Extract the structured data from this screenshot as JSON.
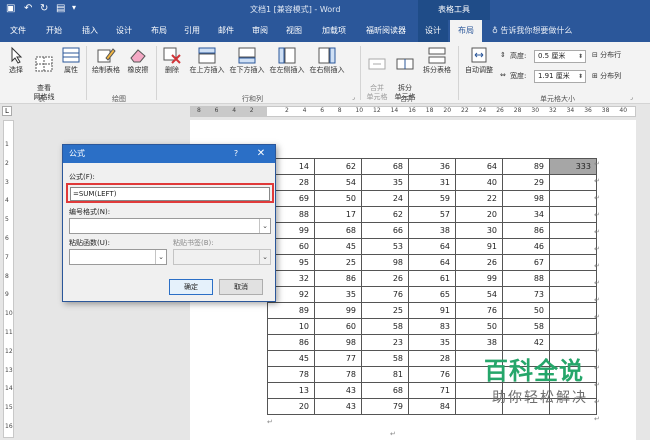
{
  "titlebar": {
    "doc_title": "文档1 [兼容模式] - Word",
    "context_group": "表格工具"
  },
  "tabs": [
    "文件",
    "开始",
    "插入",
    "设计",
    "布局",
    "引用",
    "邮件",
    "审阅",
    "视图",
    "加载项",
    "福昕阅读器",
    "设计",
    "布局"
  ],
  "tell_me": "告诉我你想要做什么",
  "ribbon": {
    "groups": {
      "table": "表",
      "draw": "绘图",
      "rows_cols": "行和列",
      "merge": "合并",
      "cell_size": "单元格大小"
    },
    "buttons": {
      "select": "选择",
      "gridlines": "查看\n网格线",
      "properties": "属性",
      "draw_table": "绘制表格",
      "eraser": "橡皮擦",
      "delete": "删除",
      "insert_above": "在上方插入",
      "insert_below": "在下方插入",
      "insert_left": "在左侧插入",
      "insert_right": "在右侧插入",
      "merge_cells": "合并\n单元格",
      "split_cells": "拆分\n单元格",
      "split_table": "拆分表格",
      "autofit": "自动调整",
      "distribute_rows": "分布行",
      "distribute_cols": "分布列"
    },
    "height_label": "高度:",
    "height_value": "0.5 厘米",
    "width_label": "宽度:",
    "width_value": "1.91 厘米"
  },
  "ruler_ticks": [
    "8",
    "6",
    "4",
    "2",
    "",
    "2",
    "4",
    "6",
    "8",
    "10",
    "12",
    "14",
    "16",
    "18",
    "20",
    "22",
    "24",
    "26",
    "28",
    "30",
    "32",
    "34",
    "36",
    "38",
    "40"
  ],
  "vruler_ticks": [
    "1",
    "2",
    "3",
    "4",
    "5",
    "6",
    "7",
    "8",
    "9",
    "10",
    "11",
    "12",
    "13",
    "14",
    "15",
    "16"
  ],
  "table": {
    "rows": [
      [
        "14",
        "62",
        "68",
        "36",
        "64",
        "89",
        "333"
      ],
      [
        "28",
        "54",
        "35",
        "31",
        "40",
        "29",
        ""
      ],
      [
        "69",
        "50",
        "24",
        "59",
        "22",
        "98",
        ""
      ],
      [
        "88",
        "17",
        "62",
        "57",
        "20",
        "34",
        ""
      ],
      [
        "99",
        "68",
        "66",
        "38",
        "30",
        "86",
        ""
      ],
      [
        "60",
        "45",
        "53",
        "64",
        "91",
        "46",
        ""
      ],
      [
        "95",
        "25",
        "98",
        "64",
        "26",
        "67",
        ""
      ],
      [
        "32",
        "86",
        "26",
        "61",
        "99",
        "88",
        ""
      ],
      [
        "92",
        "35",
        "76",
        "65",
        "54",
        "73",
        ""
      ],
      [
        "89",
        "99",
        "25",
        "91",
        "76",
        "50",
        ""
      ],
      [
        "10",
        "60",
        "58",
        "83",
        "50",
        "58",
        ""
      ],
      [
        "86",
        "98",
        "23",
        "35",
        "38",
        "42",
        ""
      ],
      [
        "45",
        "77",
        "58",
        "28",
        "",
        "",
        ""
      ],
      [
        "78",
        "78",
        "81",
        "76",
        "",
        "",
        ""
      ],
      [
        "13",
        "43",
        "68",
        "71",
        "",
        "",
        ""
      ],
      [
        "20",
        "43",
        "79",
        "84",
        "",
        "",
        ""
      ]
    ]
  },
  "dialog": {
    "title": "公式",
    "help": "?",
    "close": "✕",
    "formula_label": "公式(F):",
    "formula_value": "=SUM(LEFT)",
    "number_format_label": "编号格式(N):",
    "paste_function_label": "粘贴函数(U):",
    "paste_bookmark_label": "粘贴书签(B):",
    "ok": "确定",
    "cancel": "取消"
  },
  "watermark": {
    "main": "百科全说",
    "sub": "助你轻松解决"
  }
}
